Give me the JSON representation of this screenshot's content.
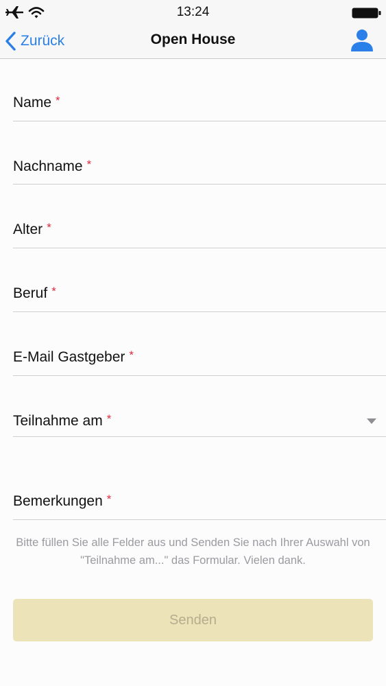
{
  "status_bar": {
    "time": "13:24",
    "icons": [
      "airplane-icon",
      "wifi-icon",
      "battery-icon"
    ]
  },
  "nav": {
    "back_label": "Zurück",
    "title": "Open House",
    "back_icon": "chevron-left-icon",
    "profile_icon": "person-icon",
    "accent_color": "#2b7fe8"
  },
  "form": {
    "required_marker": "*",
    "fields": [
      {
        "label": "Name",
        "value": ""
      },
      {
        "label": "Nachname",
        "value": ""
      },
      {
        "label": "Alter",
        "value": ""
      },
      {
        "label": "Beruf",
        "value": ""
      },
      {
        "label": "E-Mail Gastgeber",
        "value": ""
      },
      {
        "label": "Teilnahme am",
        "value": "",
        "type": "select",
        "icon": "dropdown-arrow-icon"
      },
      {
        "label": "Bemerkungen",
        "value": ""
      }
    ],
    "hint": "Bitte füllen Sie alle Felder aus und Senden Sie nach Ihrer Auswahl von \"Teilnahme am...\" das Formular. Vielen dank.",
    "submit_label": "Senden",
    "submit_color": "#ece3b8",
    "required_color": "#e0283c"
  }
}
